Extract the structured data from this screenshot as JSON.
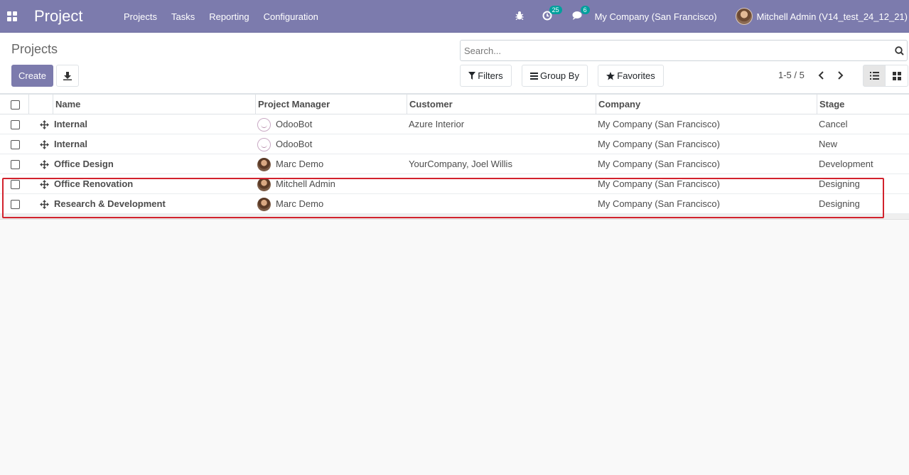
{
  "navbar": {
    "app_title": "Project",
    "menu": [
      "Projects",
      "Tasks",
      "Reporting",
      "Configuration"
    ],
    "activity_count": "25",
    "messages_count": "6",
    "company": "My Company (San Francisco)",
    "user": "Mitchell Admin (V14_test_24_12_21)"
  },
  "control_panel": {
    "breadcrumb": "Projects",
    "create_label": "Create",
    "search_placeholder": "Search...",
    "filters_label": "Filters",
    "groupby_label": "Group By",
    "favorites_label": "Favorites",
    "pager": "1-5 / 5"
  },
  "table": {
    "columns": [
      "Name",
      "Project Manager",
      "Customer",
      "Company",
      "Stage"
    ],
    "rows": [
      {
        "name": "Internal",
        "manager": "OdooBot",
        "manager_avatar": "bot",
        "customer": "Azure Interior",
        "company": "My Company (San Francisco)",
        "stage": "Cancel"
      },
      {
        "name": "Internal",
        "manager": "OdooBot",
        "manager_avatar": "bot",
        "customer": "",
        "company": "My Company (San Francisco)",
        "stage": "New"
      },
      {
        "name": "Office Design",
        "manager": "Marc Demo",
        "manager_avatar": "person",
        "customer": "YourCompany, Joel Willis",
        "company": "My Company (San Francisco)",
        "stage": "Development"
      },
      {
        "name": "Office Renovation",
        "manager": "Mitchell Admin",
        "manager_avatar": "person",
        "customer": "",
        "company": "My Company (San Francisco)",
        "stage": "Designing"
      },
      {
        "name": "Research & Development",
        "manager": "Marc Demo",
        "manager_avatar": "person",
        "customer": "",
        "company": "My Company (San Francisco)",
        "stage": "Designing"
      }
    ]
  },
  "colors": {
    "brand": "#7c7bad",
    "badge": "#00a09d",
    "highlight": "#d2222d"
  }
}
